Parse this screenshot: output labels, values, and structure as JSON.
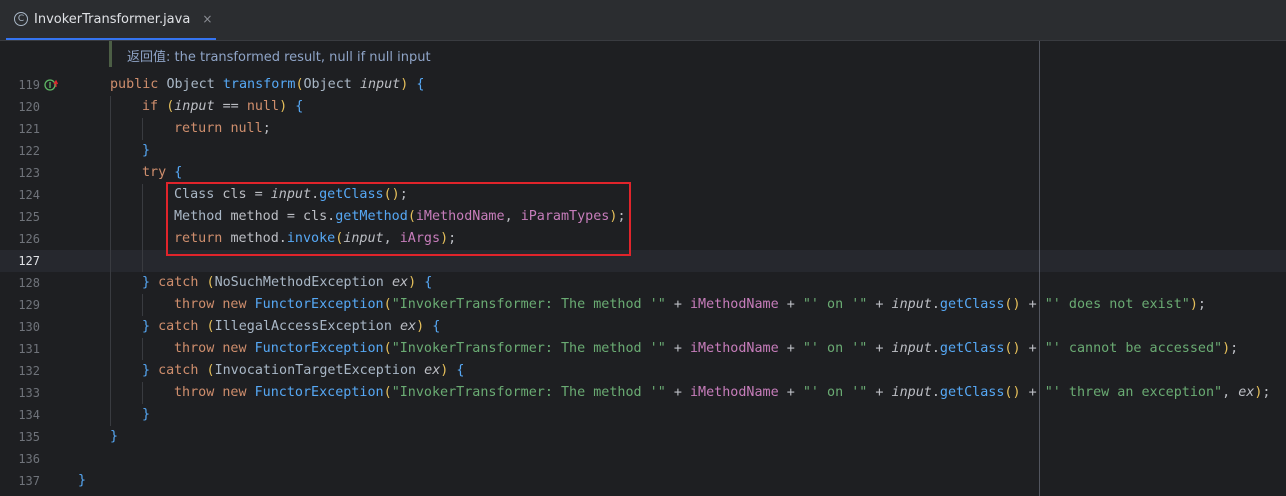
{
  "tab": {
    "title": "InvokerTransformer.java",
    "close": "×",
    "icon_letter": "C",
    "file_type_icon": "class-icon",
    "accent": "#3574F0"
  },
  "doc": {
    "label": "返回值:",
    "text": "the transformed result, null if null input"
  },
  "gutter": {
    "override_icon": "implements-method-icon"
  },
  "highlight_box": {
    "color": "#E0242B"
  },
  "lines": [
    {
      "num": "119",
      "tokens": [
        {
          "t": "public ",
          "c": "kw"
        },
        {
          "t": "Object ",
          "c": "ty"
        },
        {
          "t": "transform",
          "c": "fn"
        },
        {
          "t": "(",
          "c": "br"
        },
        {
          "t": "Object ",
          "c": "ty"
        },
        {
          "t": "input",
          "c": "pa"
        },
        {
          "t": ") ",
          "c": "br"
        },
        {
          "t": "{",
          "c": "fn"
        }
      ]
    },
    {
      "num": "120",
      "tokens": [
        {
          "t": "if ",
          "c": "kw"
        },
        {
          "t": "(",
          "c": "br"
        },
        {
          "t": "input",
          "c": "pa"
        },
        {
          "t": " == ",
          "c": "tx"
        },
        {
          "t": "null",
          "c": "kw"
        },
        {
          "t": ") ",
          "c": "br"
        },
        {
          "t": "{",
          "c": "fn"
        }
      ]
    },
    {
      "num": "121",
      "tokens": [
        {
          "t": "return ",
          "c": "kw"
        },
        {
          "t": "null",
          "c": "kw"
        },
        {
          "t": ";",
          "c": "tx"
        }
      ]
    },
    {
      "num": "122",
      "tokens": [
        {
          "t": "}",
          "c": "fn"
        }
      ]
    },
    {
      "num": "123",
      "tokens": [
        {
          "t": "try ",
          "c": "kw"
        },
        {
          "t": "{",
          "c": "fn"
        }
      ]
    },
    {
      "num": "124",
      "tokens": [
        {
          "t": "Class ",
          "c": "ty"
        },
        {
          "t": "cls = ",
          "c": "tx"
        },
        {
          "t": "input",
          "c": "pa"
        },
        {
          "t": ".",
          "c": "tx"
        },
        {
          "t": "getClass",
          "c": "fn"
        },
        {
          "t": "()",
          "c": "br"
        },
        {
          "t": ";",
          "c": "tx"
        }
      ]
    },
    {
      "num": "125",
      "tokens": [
        {
          "t": "Method ",
          "c": "ty"
        },
        {
          "t": "method = cls.",
          "c": "tx"
        },
        {
          "t": "getMethod",
          "c": "fn"
        },
        {
          "t": "(",
          "c": "br"
        },
        {
          "t": "iMethodName",
          "c": "va"
        },
        {
          "t": ", ",
          "c": "tx"
        },
        {
          "t": "iParamTypes",
          "c": "va"
        },
        {
          "t": ")",
          "c": "br"
        },
        {
          "t": ";",
          "c": "tx"
        }
      ]
    },
    {
      "num": "126",
      "tokens": [
        {
          "t": "return ",
          "c": "kw"
        },
        {
          "t": "method.",
          "c": "tx"
        },
        {
          "t": "invoke",
          "c": "fn"
        },
        {
          "t": "(",
          "c": "br"
        },
        {
          "t": "input",
          "c": "pa"
        },
        {
          "t": ", ",
          "c": "tx"
        },
        {
          "t": "iArgs",
          "c": "va"
        },
        {
          "t": ")",
          "c": "br"
        },
        {
          "t": ";",
          "c": "tx"
        }
      ]
    },
    {
      "num": "127",
      "tokens": []
    },
    {
      "num": "128",
      "tokens": [
        {
          "t": "} ",
          "c": "fn"
        },
        {
          "t": "catch ",
          "c": "kw"
        },
        {
          "t": "(",
          "c": "br"
        },
        {
          "t": "NoSuchMethodException ",
          "c": "ty"
        },
        {
          "t": "ex",
          "c": "pa"
        },
        {
          "t": ") ",
          "c": "br"
        },
        {
          "t": "{",
          "c": "fn"
        }
      ]
    },
    {
      "num": "129",
      "tokens": [
        {
          "t": "throw ",
          "c": "kw"
        },
        {
          "t": "new ",
          "c": "kw"
        },
        {
          "t": "FunctorException",
          "c": "fn"
        },
        {
          "t": "(",
          "c": "br"
        },
        {
          "t": "\"InvokerTransformer: The method '\"",
          "c": "st"
        },
        {
          "t": " + ",
          "c": "tx"
        },
        {
          "t": "iMethodName",
          "c": "va"
        },
        {
          "t": " + ",
          "c": "tx"
        },
        {
          "t": "\"' on '\"",
          "c": "st"
        },
        {
          "t": " + ",
          "c": "tx"
        },
        {
          "t": "input",
          "c": "pa"
        },
        {
          "t": ".",
          "c": "tx"
        },
        {
          "t": "getClass",
          "c": "fn"
        },
        {
          "t": "()",
          "c": "br"
        },
        {
          "t": " + ",
          "c": "tx"
        },
        {
          "t": "\"' does not exist\"",
          "c": "st"
        },
        {
          "t": ")",
          "c": "br"
        },
        {
          "t": ";",
          "c": "tx"
        }
      ]
    },
    {
      "num": "130",
      "tokens": [
        {
          "t": "} ",
          "c": "fn"
        },
        {
          "t": "catch ",
          "c": "kw"
        },
        {
          "t": "(",
          "c": "br"
        },
        {
          "t": "IllegalAccessException ",
          "c": "ty"
        },
        {
          "t": "ex",
          "c": "pa"
        },
        {
          "t": ") ",
          "c": "br"
        },
        {
          "t": "{",
          "c": "fn"
        }
      ]
    },
    {
      "num": "131",
      "tokens": [
        {
          "t": "throw ",
          "c": "kw"
        },
        {
          "t": "new ",
          "c": "kw"
        },
        {
          "t": "FunctorException",
          "c": "fn"
        },
        {
          "t": "(",
          "c": "br"
        },
        {
          "t": "\"InvokerTransformer: The method '\"",
          "c": "st"
        },
        {
          "t": " + ",
          "c": "tx"
        },
        {
          "t": "iMethodName",
          "c": "va"
        },
        {
          "t": " + ",
          "c": "tx"
        },
        {
          "t": "\"' on '\"",
          "c": "st"
        },
        {
          "t": " + ",
          "c": "tx"
        },
        {
          "t": "input",
          "c": "pa"
        },
        {
          "t": ".",
          "c": "tx"
        },
        {
          "t": "getClass",
          "c": "fn"
        },
        {
          "t": "()",
          "c": "br"
        },
        {
          "t": " + ",
          "c": "tx"
        },
        {
          "t": "\"' cannot be accessed\"",
          "c": "st"
        },
        {
          "t": ")",
          "c": "br"
        },
        {
          "t": ";",
          "c": "tx"
        }
      ]
    },
    {
      "num": "132",
      "tokens": [
        {
          "t": "} ",
          "c": "fn"
        },
        {
          "t": "catch ",
          "c": "kw"
        },
        {
          "t": "(",
          "c": "br"
        },
        {
          "t": "InvocationTargetException ",
          "c": "ty"
        },
        {
          "t": "ex",
          "c": "pa"
        },
        {
          "t": ") ",
          "c": "br"
        },
        {
          "t": "{",
          "c": "fn"
        }
      ]
    },
    {
      "num": "133",
      "tokens": [
        {
          "t": "throw ",
          "c": "kw"
        },
        {
          "t": "new ",
          "c": "kw"
        },
        {
          "t": "FunctorException",
          "c": "fn"
        },
        {
          "t": "(",
          "c": "br"
        },
        {
          "t": "\"InvokerTransformer: The method '\"",
          "c": "st"
        },
        {
          "t": " + ",
          "c": "tx"
        },
        {
          "t": "iMethodName",
          "c": "va"
        },
        {
          "t": " + ",
          "c": "tx"
        },
        {
          "t": "\"' on '\"",
          "c": "st"
        },
        {
          "t": " + ",
          "c": "tx"
        },
        {
          "t": "input",
          "c": "pa"
        },
        {
          "t": ".",
          "c": "tx"
        },
        {
          "t": "getClass",
          "c": "fn"
        },
        {
          "t": "()",
          "c": "br"
        },
        {
          "t": " + ",
          "c": "tx"
        },
        {
          "t": "\"' threw an exception\"",
          "c": "st"
        },
        {
          "t": ", ",
          "c": "tx"
        },
        {
          "t": "ex",
          "c": "pa"
        },
        {
          "t": ")",
          "c": "br"
        },
        {
          "t": ";",
          "c": "tx"
        }
      ]
    },
    {
      "num": "134",
      "tokens": [
        {
          "t": "}",
          "c": "fn"
        }
      ]
    },
    {
      "num": "135",
      "tokens": [
        {
          "t": "}",
          "c": "fn"
        }
      ]
    },
    {
      "num": "136",
      "tokens": []
    },
    {
      "num": "137",
      "tokens": [
        {
          "t": "}",
          "c": "fn"
        }
      ]
    }
  ]
}
